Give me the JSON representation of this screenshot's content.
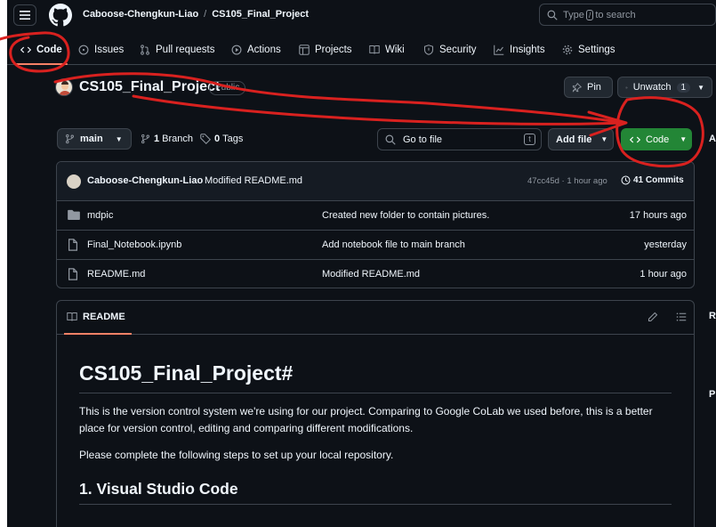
{
  "header": {
    "owner": "Caboose-Chengkun-Liao",
    "separator": "/",
    "repo": "CS105_Final_Project",
    "search": {
      "prefix": "Type",
      "key": "/",
      "suffix": "to search"
    }
  },
  "nav": {
    "tabs": [
      {
        "label": "Code",
        "icon": "code-icon",
        "selected": true
      },
      {
        "label": "Issues",
        "icon": "issue-icon"
      },
      {
        "label": "Pull requests",
        "icon": "pull-request-icon"
      },
      {
        "label": "Actions",
        "icon": "play-icon"
      },
      {
        "label": "Projects",
        "icon": "table-icon"
      },
      {
        "label": "Wiki",
        "icon": "book-icon"
      },
      {
        "label": "Security",
        "icon": "shield-icon"
      },
      {
        "label": "Insights",
        "icon": "graph-icon"
      },
      {
        "label": "Settings",
        "icon": "gear-icon"
      }
    ]
  },
  "repo": {
    "name": "CS105_Final_Project",
    "visibility": "Public",
    "pin_label": "Pin",
    "watch_label": "Unwatch",
    "watch_count": "1"
  },
  "branch_bar": {
    "branch": "main",
    "branches_count": "1",
    "branches_label": "Branch",
    "tags_count": "0",
    "tags_label": "Tags",
    "goto_placeholder": "Go to file",
    "goto_key": "t",
    "add_file": "Add file",
    "code_label": "Code"
  },
  "latest_commit": {
    "author": "Caboose-Chengkun-Liao",
    "message": "Modified README.md",
    "sha_info": "47cc45d · 1 hour ago",
    "commits_label": "41 Commits"
  },
  "files": [
    {
      "type": "folder",
      "name": "mdpic",
      "message": "Created new folder to contain pictures.",
      "age": "17 hours ago"
    },
    {
      "type": "file",
      "name": "Final_Notebook.ipynb",
      "message": "Add notebook file to main branch",
      "age": "yesterday"
    },
    {
      "type": "file",
      "name": "README.md",
      "message": "Modified README.md",
      "age": "1 hour ago"
    }
  ],
  "readme": {
    "tab_label": "README",
    "h1": "CS105_Final_Project#",
    "p1": "This is the version control system we're using for our project. Comparing to Google CoLab we used before, this is a better place for version control, editing and comparing different modifications.",
    "p2": "Please complete the following steps to set up your local repository.",
    "h2": "1. Visual Studio Code"
  },
  "sidebar_fragments": {
    "about": "A",
    "releases": "R",
    "packages": "P"
  },
  "colors": {
    "bg": "#0d1117",
    "accent_green": "#238636",
    "underline": "#f78166",
    "annotation": "#d9211f"
  }
}
